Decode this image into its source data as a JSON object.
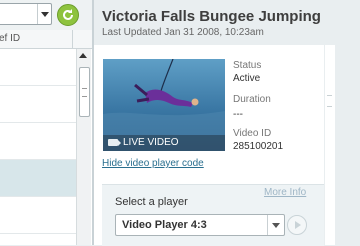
{
  "list_pane": {
    "column_header": "ef ID",
    "dropdown_value": ""
  },
  "detail": {
    "title": "Victoria Falls Bungee Jumping",
    "last_updated": "Last Updated Jan 31 2008, 10:23am",
    "thumbnail": {
      "badge": "LIVE VIDEO"
    },
    "hide_link": "Hide video player code",
    "fields": [
      {
        "label": "Status",
        "value": "Active"
      },
      {
        "label": "Duration",
        "value": "---"
      },
      {
        "label": "Video ID",
        "value": "285100201"
      }
    ],
    "player": {
      "more_info": "More Info",
      "select_label": "Select a player",
      "selected": "Video Player 4:3"
    }
  },
  "colors": {
    "refresh_green": "#8ec33e",
    "selected_row": "#d7e6ea",
    "link": "#2a6f8f"
  }
}
